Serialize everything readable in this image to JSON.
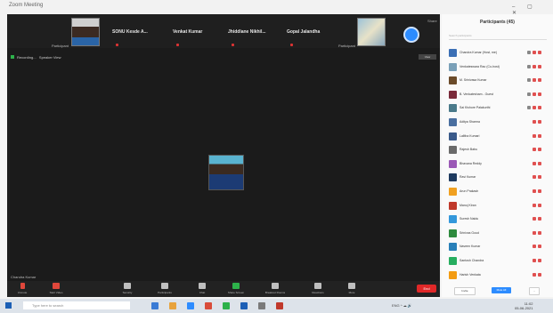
{
  "window": {
    "title": "Zoom Meeting"
  },
  "window_controls": "– ▢ ✕",
  "gallery": {
    "left_thumb_name": "Participant",
    "right_thumb_name": "Participant",
    "tiles": [
      "SONU Kesde A...",
      "Venkat Kumar",
      "Jhiddlane Nikhil...",
      "Gopal Jalandha"
    ],
    "corner_text": "Share"
  },
  "info_bar": {
    "recording": "Recording...",
    "view_label": "Speaker View",
    "view_btn": "View"
  },
  "self_label": "Chandra Kumar",
  "toolbar": {
    "items": [
      {
        "label": "Unmute"
      },
      {
        "label": "Start Video"
      },
      {
        "label": "Security"
      },
      {
        "label": "Participants"
      },
      {
        "label": "Chat"
      },
      {
        "label": "Share Screen"
      },
      {
        "label": "Breakout Rooms"
      },
      {
        "label": "Reactions"
      },
      {
        "label": "More"
      }
    ],
    "end_label": "End"
  },
  "panel": {
    "title": "Participants (45)",
    "search_placeholder": "Search participants",
    "participants": [
      {
        "name": "Chandra Kumar (Host, me)",
        "color": "#3b6fb5"
      },
      {
        "name": "Venkateswara Rao (Co-host)",
        "color": "#7aa0b8"
      },
      {
        "name": "M. Srinivasa Kumar",
        "color": "#6b4b2a"
      },
      {
        "name": "B. Venkatesham - Guest",
        "color": "#7a2a3a"
      },
      {
        "name": "Sai Kishore Palakurthi",
        "color": "#4a7a8a"
      },
      {
        "name": "Aditya Sharma",
        "color": "#4a6fa0"
      },
      {
        "name": "Lalitha Kumari",
        "color": "#3a5a8a"
      },
      {
        "name": "Rajesh Babu",
        "color": "#6a6a6a"
      },
      {
        "name": "Bhavana Reddy",
        "color": "#9b59b6"
      },
      {
        "name": "Ravi Kumar",
        "color": "#1e3a5f"
      },
      {
        "name": "Arun Prakash",
        "color": "#f0a020"
      },
      {
        "name": "Manoj Kiran",
        "color": "#c0392b"
      },
      {
        "name": "Suresh Naidu",
        "color": "#3498db"
      },
      {
        "name": "Srinivas Goud",
        "color": "#2e8b3e"
      },
      {
        "name": "Naveen Kumar",
        "color": "#2980b9"
      },
      {
        "name": "Santosh Chandra",
        "color": "#27ae60"
      },
      {
        "name": "Harish Venkata",
        "color": "#f39c12"
      }
    ],
    "invite_label": "Invite",
    "mute_all_label": "Mute All",
    "more_label": "..."
  },
  "taskbar": {
    "search_placeholder": "Type here to search",
    "app_colors": [
      "#3a7bd5",
      "#e8a33d",
      "#2d8cff",
      "#d94c3a",
      "#2db14a",
      "#1c5fb5",
      "#7a7a7a",
      "#c0392b"
    ],
    "tray_text": "ENG ^ ☁ 🔊",
    "time": "11:02",
    "date": "05-06-2021"
  }
}
